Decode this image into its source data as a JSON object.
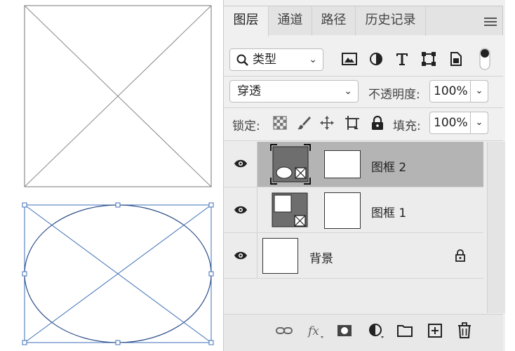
{
  "tabs": [
    {
      "label": "图层",
      "active": true
    },
    {
      "label": "通道",
      "active": false
    },
    {
      "label": "路径",
      "active": false
    },
    {
      "label": "历史记录",
      "active": false
    }
  ],
  "filter": {
    "kind_label": "类型",
    "icons": [
      "image-filter-icon",
      "adjustment-filter-icon",
      "type-filter-icon",
      "shape-filter-icon",
      "smart-object-filter-icon",
      "filter-toggle-icon"
    ]
  },
  "blend": {
    "mode": "穿透",
    "opacity_label": "不透明度:",
    "opacity_value": "100%"
  },
  "lock": {
    "label": "锁定:",
    "icons": [
      "lock-transparent-icon",
      "lock-image-icon",
      "lock-position-icon",
      "lock-artboard-icon",
      "lock-all-icon"
    ],
    "fill_label": "填充:",
    "fill_value": "100%"
  },
  "layers": [
    {
      "name": "图框 2",
      "selected": true,
      "type": "frame-ellipse"
    },
    {
      "name": "图框 1",
      "selected": false,
      "type": "frame-rect"
    },
    {
      "name": "背景",
      "selected": false,
      "type": "background",
      "locked": true
    }
  ],
  "bottom_icons": [
    "link-icon",
    "fx-icon",
    "mask-icon",
    "adjustment-layer-icon",
    "group-folder-icon",
    "new-layer-icon",
    "delete-icon"
  ],
  "colors": {
    "selection_blue": "#3d6fb7",
    "selected_row": "#b4b4b4",
    "panel_bg": "#f0f0f0"
  }
}
